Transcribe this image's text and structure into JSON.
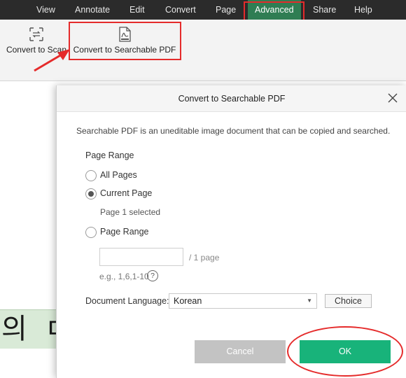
{
  "menu": {
    "items": [
      {
        "label": "View"
      },
      {
        "label": "Annotate"
      },
      {
        "label": "Edit"
      },
      {
        "label": "Convert"
      },
      {
        "label": "Page"
      },
      {
        "label": "Advanced",
        "active": true
      },
      {
        "label": "Share"
      },
      {
        "label": "Help"
      }
    ]
  },
  "ribbon": {
    "convert_to_scan": {
      "label": "Convert to Scan",
      "icon": "convert-scan-icon"
    },
    "convert_to_searchable": {
      "label": "Convert to Searchable PDF",
      "icon": "searchable-pdf-icon"
    }
  },
  "document": {
    "visible_text": "의 ㄷ"
  },
  "dialog": {
    "title": "Convert to Searchable PDF",
    "description": "Searchable PDF is an uneditable image document that can be copied and searched.",
    "page_range_section": "Page Range",
    "options": {
      "all_pages": "All Pages",
      "current_page": "Current Page",
      "page_range": "Page Range"
    },
    "selected_option": "current_page",
    "current_page_note": "Page 1 selected",
    "range_input": {
      "value": "",
      "suffix": "/ 1 page",
      "example": "e.g., 1,6,1-10"
    },
    "help_glyph": "?",
    "language": {
      "label": "Document Language:",
      "value": "Korean"
    },
    "choice_label": "Choice",
    "cancel_label": "Cancel",
    "ok_label": "OK"
  },
  "colors": {
    "menubar_bg": "#2b2b2b",
    "active_tab": "#2f7d53",
    "ok_button": "#18b37a",
    "cancel_button": "#c3c3c3",
    "annotation_red": "#e52b2b"
  }
}
